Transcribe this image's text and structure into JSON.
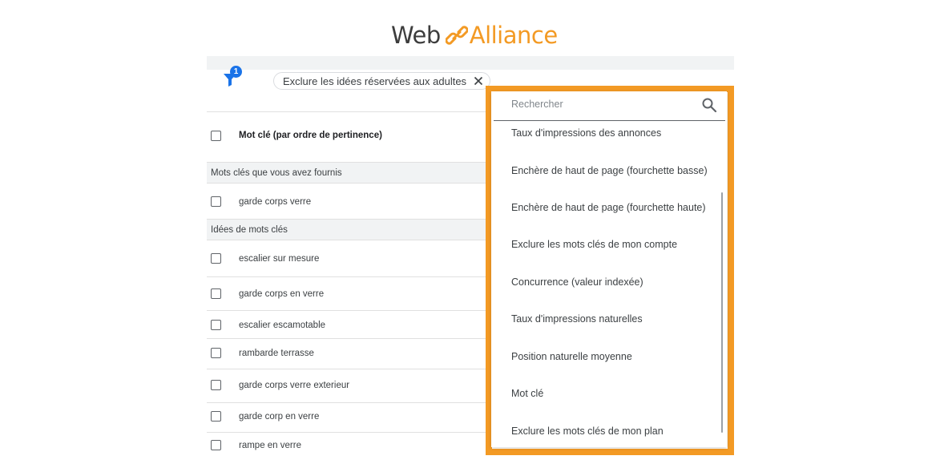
{
  "logo": {
    "part1": "Web",
    "part2": "Alliance",
    "accent_color": "#f39a24"
  },
  "filter": {
    "badge_count": "1",
    "chip_label": "Exclure les idées réservées aux adultes"
  },
  "table": {
    "header": "Mot clé (par ordre de pertinence)",
    "section_provided": "Mots clés que vous avez fournis",
    "provided_rows": [
      "garde corps verre"
    ],
    "section_ideas": "Idées de mots clés",
    "idea_rows": [
      "escalier sur mesure",
      "garde corps en verre",
      "escalier escamotable",
      "rambarde terrasse",
      "garde corps verre exterieur",
      "garde corp en verre",
      "rampe en verre"
    ]
  },
  "dropdown": {
    "search_placeholder": "Rechercher",
    "options": [
      "Taux d'impressions des annonces",
      "Enchère de haut de page (fourchette basse)",
      "Enchère de haut de page (fourchette haute)",
      "Exclure les mots clés de mon compte",
      "Concurrence (valeur indexée)",
      "Taux d'impressions naturelles",
      "Position naturelle moyenne",
      "Mot clé",
      "Exclure les mots clés de mon plan"
    ]
  }
}
